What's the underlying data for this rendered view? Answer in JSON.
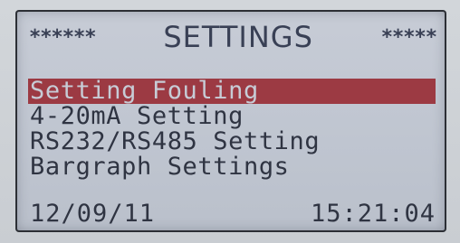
{
  "header": {
    "left_decoration": "******",
    "title": "SETTINGS",
    "right_decoration": "*****"
  },
  "menu": {
    "items": [
      {
        "label": "Setting Fouling",
        "selected": true
      },
      {
        "label": "4-20mA Setting",
        "selected": false
      },
      {
        "label": "RS232/RS485 Setting",
        "selected": false
      },
      {
        "label": "Bargraph Settings",
        "selected": false
      }
    ]
  },
  "status": {
    "date": "12/09/11",
    "time": "15:21:04"
  },
  "colors": {
    "lcd_background": "#c4c9d3",
    "lcd_text": "#2f3442",
    "selection_highlight": "#9c3a43"
  }
}
